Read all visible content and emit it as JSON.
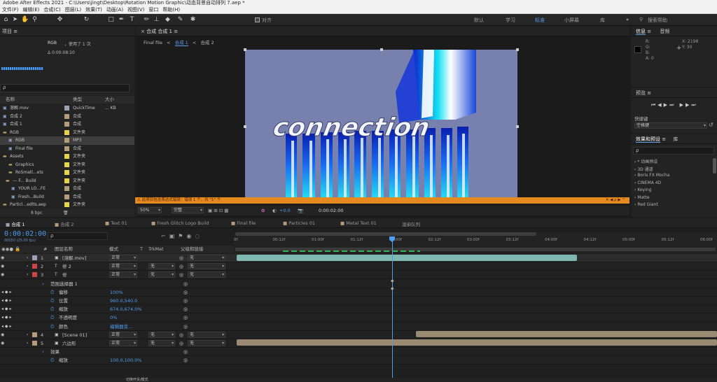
{
  "window": {
    "title": "Adobe After Effects 2021 - C:\\Users\\jingt\\Desktop\\Rotation Motion Graphic\\动态背景自动排列 7.aep *"
  },
  "menu": [
    "文件(F)",
    "编辑(E)",
    "合成(C)",
    "图层(L)",
    "效果(T)",
    "动画(A)",
    "视图(V)",
    "窗口",
    "帮助(H)"
  ],
  "toolbar": {
    "snap_label": "对齐",
    "workspaces": [
      "默认",
      "学习",
      "标准",
      "小屏幕",
      "库"
    ],
    "active_workspace": "标准",
    "search_placeholder": "搜索帮助"
  },
  "project": {
    "title": "项目",
    "selected": "RGB",
    "usage": "，使用了 1 次",
    "duration": "Δ 0:00:08:10",
    "search_placeholder": "ρ",
    "columns": {
      "name": "名称",
      "type": "类型",
      "size": "大小"
    },
    "items": [
      {
        "name": "溶解.mov",
        "type": "QuickTime",
        "size": "... KB",
        "color": "#9aa3b5"
      },
      {
        "name": "合成 2",
        "type": "合成",
        "size": "",
        "color": "#b39c7a"
      },
      {
        "name": "合成 1",
        "type": "合成",
        "size": "",
        "color": "#b39c7a"
      },
      {
        "name": "RGB",
        "type": "文件夹",
        "size": "",
        "color": "#e8d24a"
      },
      {
        "name": "RGB",
        "type": "MP3",
        "size": "",
        "color": "#b39c7a"
      },
      {
        "name": "Final file",
        "type": "合成",
        "size": "",
        "color": "#b39c7a"
      },
      {
        "name": "Assets",
        "type": "文件夹",
        "size": "",
        "color": "#e8d24a"
      },
      {
        "name": "Graphics",
        "type": "文件夹",
        "size": "",
        "color": "#e8d24a"
      },
      {
        "name": "RoSmatl...ets",
        "type": "文件夹",
        "size": "",
        "color": "#e8d24a"
      },
      {
        "name": "--- F... Build",
        "type": "文件夹",
        "size": "",
        "color": "#e8d24a"
      },
      {
        "name": "YOUR LO...FE",
        "type": "合成",
        "size": "",
        "color": "#b39c7a"
      },
      {
        "name": "Fresh...Build",
        "type": "合成",
        "size": "",
        "color": "#b39c7a"
      },
      {
        "name": "Particl...edlts.aep",
        "type": "文件夹",
        "size": "",
        "color": "#e8d24a"
      }
    ],
    "bpc": "8 bpc"
  },
  "viewer": {
    "panel_title": "合成 合成 1",
    "breadcrumbs": [
      "Final file",
      "合成 1",
      "合成 2"
    ],
    "text": "connection",
    "warning": "此项目包含表达式错误：错误 1 个，共 \"1\" 个",
    "zoom": "50%",
    "quality": "完整",
    "exposure": "+0.0",
    "timecode": "0:00:02:00"
  },
  "info": {
    "tabs": [
      "信息",
      "音频"
    ],
    "r": "R:",
    "g": "G:",
    "b": "B:",
    "a": "A: 0",
    "x": "X: 2198",
    "y": "Y: 30"
  },
  "preview": {
    "title": "预览",
    "shortcut_label": "快捷键",
    "shortcut_value": "空格键"
  },
  "effects": {
    "tabs": [
      "效果和预设",
      "库"
    ],
    "search_placeholder": "ρ",
    "items": [
      "* 动画预设",
      "3D 通道",
      "Boris FX Mocha",
      "CINEMA 4D",
      "Keying",
      "Matte",
      "Red Giant"
    ]
  },
  "timeline": {
    "tabs": [
      "合成 1",
      "合成 2",
      "Text 01",
      "Fresh Glitch Logo Build",
      "Final file",
      "Particles 01",
      "Metal Text 01",
      "渲染队列"
    ],
    "timecode": "0:00:02:00",
    "frames": "00050 (25.00 fps)",
    "search_placeholder": "ρ",
    "columns": {
      "name": "图层名称",
      "mode": "模式",
      "t": "T",
      "trkmat": "TrkMat",
      "parent": "父级和链接"
    },
    "ruler": [
      "0f",
      "00:12f",
      "01:00f",
      "01:12f",
      "02:00f",
      "02:12f",
      "03:00f",
      "03:12f",
      "04:00f",
      "04:12f",
      "05:00f",
      "05:12f",
      "06:00f"
    ],
    "layers": [
      {
        "num": "1",
        "name": "[溶解.mov]",
        "mode": "正常",
        "trkmat": "",
        "parent": "无",
        "color": "#9aa3b5"
      },
      {
        "num": "2",
        "name": "修 2",
        "mode": "正常",
        "trkmat": "无",
        "parent": "无",
        "color": "#cc4444"
      },
      {
        "num": "3",
        "name": "修",
        "mode": "正常",
        "trkmat": "无",
        "parent": "无",
        "color": "#cc4444"
      },
      {
        "num": "",
        "name": "范围选择器 1",
        "mode": "",
        "trkmat": "",
        "parent": "",
        "color": ""
      },
      {
        "num": "",
        "name": "偏移",
        "value": "100%",
        "color": ""
      },
      {
        "num": "",
        "name": "位置",
        "value": "960.0,540.0",
        "color": ""
      },
      {
        "num": "",
        "name": "缩放",
        "value": "674.0,674.0%",
        "color": ""
      },
      {
        "num": "",
        "name": "不透明度",
        "value": "0%",
        "color": ""
      },
      {
        "num": "",
        "name": "颜色",
        "value": "编辑器变...",
        "color": ""
      },
      {
        "num": "4",
        "name": "[Scene 01]",
        "mode": "正常",
        "trkmat": "无",
        "parent": "无",
        "color": "#b39c7a"
      },
      {
        "num": "5",
        "name": "六边形",
        "mode": "正常",
        "trkmat": "无",
        "parent": "无",
        "color": "#b39c7a"
      },
      {
        "num": "",
        "name": "效果",
        "value": "",
        "color": ""
      },
      {
        "num": "",
        "name": "缩放",
        "value": "100.0,100.0%",
        "color": ""
      }
    ],
    "footer": "切换开关/模式"
  }
}
